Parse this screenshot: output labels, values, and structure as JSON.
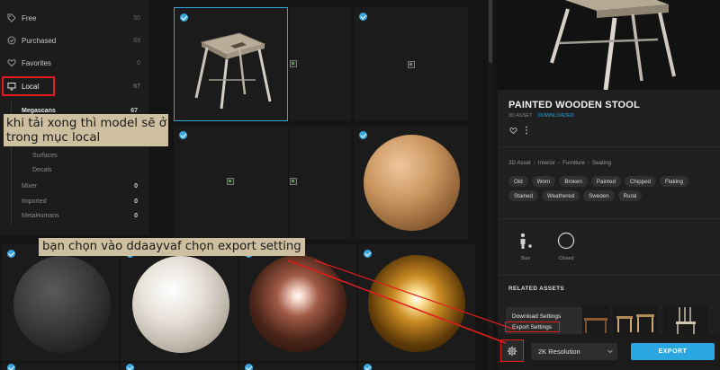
{
  "sidebar": {
    "items": [
      {
        "label": "Free",
        "count": "50",
        "icon": "tag-icon"
      },
      {
        "label": "Purchased",
        "count": "69",
        "icon": "check-circle-icon"
      },
      {
        "label": "Favorites",
        "count": "0",
        "icon": "heart-icon"
      },
      {
        "label": "Local",
        "count": "67",
        "icon": "monitor-icon"
      }
    ],
    "sub_items": [
      {
        "label": "Megascans",
        "count": "67"
      },
      {
        "label": "Surfaces",
        "count": ""
      },
      {
        "label": "Decals",
        "count": ""
      },
      {
        "label": "Mixer",
        "count": "0"
      },
      {
        "label": "Imported",
        "count": "0"
      },
      {
        "label": "MetaHumans",
        "count": "0"
      }
    ]
  },
  "annotations": {
    "note1": "khi tải xong thì model sẽ ở trong mục local",
    "note2": "bạn chọn vào ddaayvaf chọn export setting"
  },
  "asset": {
    "title": "PAINTED WOODEN STOOL",
    "type": "3D ASSET",
    "status": "DOWNLOADED",
    "breadcrumb": [
      "3D Asset",
      "Interior",
      "Furniture",
      "Seating"
    ],
    "tags": [
      "Old",
      "Worn",
      "Broken",
      "Painted",
      "Chipped",
      "Flaking",
      "Stained",
      "Weathered",
      "Sweden",
      "Rural"
    ],
    "specs": [
      {
        "label": "Size",
        "icon": "person-scale-icon"
      },
      {
        "label": "Closed",
        "icon": "circle-icon"
      }
    ],
    "related_title": "RELATED ASSETS"
  },
  "menu": {
    "download_settings": "Download Settings",
    "export_settings": "Export Settings"
  },
  "footer": {
    "resolution": "2K Resolution",
    "export_label": "EXPORT"
  },
  "colors": {
    "accent": "#2aa7e0",
    "highlight": "#e21c1c",
    "note_bg": "#cdbfa0"
  }
}
